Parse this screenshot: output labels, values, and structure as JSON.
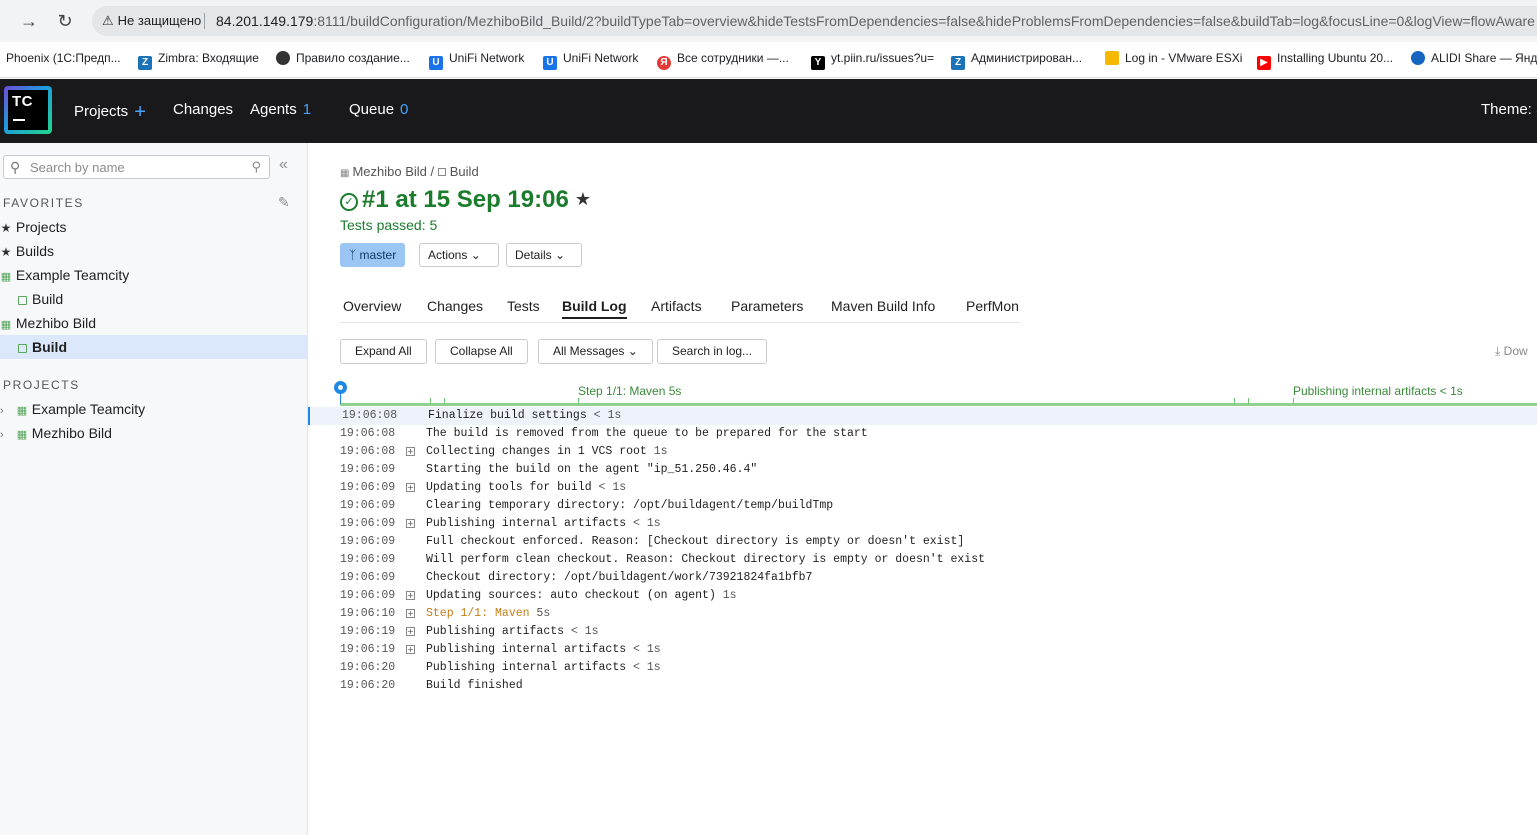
{
  "browser": {
    "security": "Не защищено",
    "url_host": "84.201.149.179",
    "url_rest": ":8111/buildConfiguration/MezhiboBild_Build/2?buildTypeTab=overview&hideTestsFromDependencies=false&hideProblemsFromDependencies=false&buildTab=log&focusLine=0&logView=flowAware",
    "bookmarks": [
      {
        "label": "Phoenix (1С:Предп...",
        "icon": "none"
      },
      {
        "label": "Zimbra: Входящие",
        "icon": "zimbra-icon",
        "color": "#1a73b8"
      },
      {
        "label": "Правило создание...",
        "icon": "globe-icon",
        "color": "#333333"
      },
      {
        "label": "UniFi Network",
        "icon": "unifi-icon",
        "color": "#1a73e8"
      },
      {
        "label": "UniFi Network",
        "icon": "unifi-icon",
        "color": "#1a73e8"
      },
      {
        "label": "Все сотрудники —...",
        "icon": "yandex-icon",
        "color": "#e53935"
      },
      {
        "label": "yt.piin.ru/issues?u=",
        "icon": "youtrack-icon",
        "color": "#000000"
      },
      {
        "label": "Администрирован...",
        "icon": "zimbra-icon",
        "color": "#1a73b8"
      },
      {
        "label": "Log in - VMware ESXi",
        "icon": "vmware-icon",
        "color": "#f6b900"
      },
      {
        "label": "Installing Ubuntu 20...",
        "icon": "youtube-icon",
        "color": "#ff0000"
      },
      {
        "label": "ALIDI Share — Янде",
        "icon": "cloud-icon",
        "color": "#1565c0"
      }
    ]
  },
  "header": {
    "projects": "Projects",
    "changes": "Changes",
    "agents": "Agents",
    "agents_count": "1",
    "queue": "Queue",
    "queue_count": "0",
    "theme": "Theme: S",
    "logo": "TC"
  },
  "sidebar": {
    "search_placeholder": "Search by name",
    "favorites_title": "FAVORITES",
    "favorites": [
      {
        "label": "Projects"
      },
      {
        "label": "Builds"
      },
      {
        "label": "Example Teamcity"
      },
      {
        "label": "Build"
      },
      {
        "label": "Mezhibo Bild"
      },
      {
        "label": "Build"
      }
    ],
    "projects_title": "PROJECTS",
    "projects": [
      {
        "label": "Example Teamcity"
      },
      {
        "label": "Mezhibo Bild"
      }
    ]
  },
  "main": {
    "breadcrumb_project": "Mezhibo Bild",
    "breadcrumb_sep": "/",
    "breadcrumb_build": "Build",
    "title": "#1 at 15 Sep 19:06",
    "tests": "Tests passed: 5",
    "branch": "master",
    "actions": "Actions",
    "details": "Details",
    "tabs": [
      "Overview",
      "Changes",
      "Tests",
      "Build Log",
      "Artifacts",
      "Parameters",
      "Maven Build Info",
      "PerfMon"
    ],
    "active_tab": "Build Log",
    "buttons": {
      "expand": "Expand All",
      "collapse": "Collapse All",
      "messages": "All Messages",
      "search": "Search in log..."
    },
    "download": "Dow",
    "timeline": {
      "step_label": "Step 1/1: Maven 5s",
      "publish_label": "Publishing internal artifacts < 1s"
    },
    "log": [
      {
        "time": "19:06:08",
        "msg": "Finalize build settings",
        "dur": "< 1s",
        "expandable": false,
        "step": false
      },
      {
        "time": "19:06:08",
        "msg": "The build is removed from the queue to be prepared for the start",
        "dur": "",
        "expandable": false,
        "step": false
      },
      {
        "time": "19:06:08",
        "msg": "Collecting changes in 1 VCS root",
        "dur": "1s",
        "expandable": true,
        "step": false
      },
      {
        "time": "19:06:09",
        "msg": "Starting the build on the agent \"ip_51.250.46.4\"",
        "dur": "",
        "expandable": false,
        "step": false
      },
      {
        "time": "19:06:09",
        "msg": "Updating tools for build",
        "dur": "< 1s",
        "expandable": true,
        "step": false
      },
      {
        "time": "19:06:09",
        "msg": "Clearing temporary directory: /opt/buildagent/temp/buildTmp",
        "dur": "",
        "expandable": false,
        "step": false
      },
      {
        "time": "19:06:09",
        "msg": "Publishing internal artifacts",
        "dur": "< 1s",
        "expandable": true,
        "step": false
      },
      {
        "time": "19:06:09",
        "msg": "Full checkout enforced. Reason: [Checkout directory is empty or doesn't exist]",
        "dur": "",
        "expandable": false,
        "step": false
      },
      {
        "time": "19:06:09",
        "msg": "Will perform clean checkout. Reason: Checkout directory is empty or doesn't exist",
        "dur": "",
        "expandable": false,
        "step": false
      },
      {
        "time": "19:06:09",
        "msg": "Checkout directory: /opt/buildagent/work/73921824fa1bfb7",
        "dur": "",
        "expandable": false,
        "step": false
      },
      {
        "time": "19:06:09",
        "msg": "Updating sources: auto checkout (on agent)",
        "dur": "1s",
        "expandable": true,
        "step": false
      },
      {
        "time": "19:06:10",
        "msg": "Step 1/1: Maven",
        "dur": "5s",
        "expandable": true,
        "step": true
      },
      {
        "time": "19:06:19",
        "msg": "Publishing artifacts",
        "dur": "< 1s",
        "expandable": true,
        "step": false
      },
      {
        "time": "19:06:19",
        "msg": "Publishing internal artifacts",
        "dur": "< 1s",
        "expandable": true,
        "step": false
      },
      {
        "time": "19:06:20",
        "msg": "Publishing internal artifacts",
        "dur": "< 1s",
        "expandable": false,
        "step": false
      },
      {
        "time": "19:06:20",
        "msg": "Build finished",
        "dur": "",
        "expandable": false,
        "step": false
      }
    ]
  }
}
